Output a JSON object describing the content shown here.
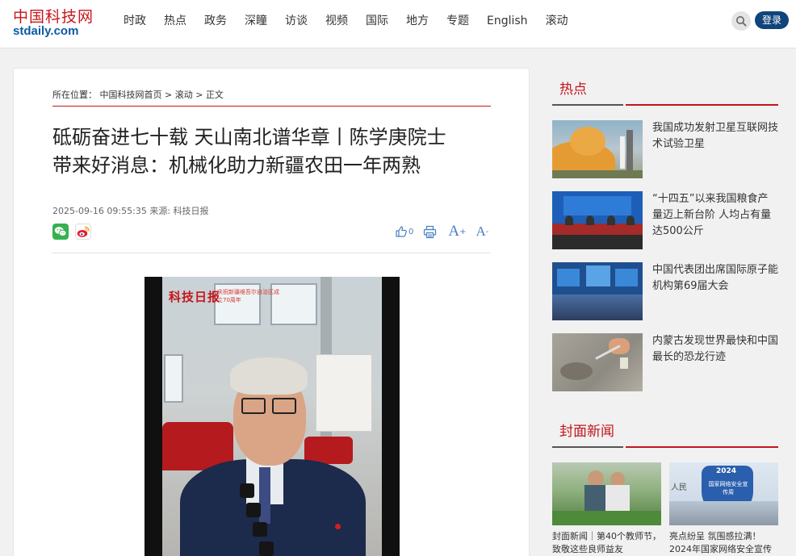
{
  "header": {
    "logo_cn": "中国科技网",
    "logo_en": "stdaily.com",
    "nav": [
      "时政",
      "热点",
      "政务",
      "深瞳",
      "访谈",
      "视频",
      "国际",
      "地方",
      "专题",
      "English",
      "滚动"
    ],
    "login": "登录"
  },
  "article": {
    "breadcrumb_label": "所在位置：",
    "breadcrumb_home": "中国科技网首页",
    "breadcrumb_sep": ">",
    "breadcrumb_section": "滚动",
    "breadcrumb_current": "正文",
    "title_line1": "砥砺奋进七十载 天山南北谱华章丨陈学庚院士",
    "title_line2": "带来好消息：机械化助力新疆农田一年两熟",
    "meta": "2025-09-16 09:55:35 来源: 科技日报",
    "likes": "0",
    "font_big": "A",
    "font_small": "A",
    "font_plus": "+",
    "font_minus": "-",
    "video_logo": "科技日报",
    "video_caption": "庆祝新疆维吾尔自治区成立70周年"
  },
  "sidebar": {
    "hot_title": "热点",
    "hot_items": [
      {
        "text": "我国成功发射卫星互联网技术试验卫星"
      },
      {
        "text": "“十四五”以来我国粮食产量迈上新台阶 人均占有量达500公斤"
      },
      {
        "text": "中国代表团出席国际原子能机构第69届大会"
      },
      {
        "text": "内蒙古发现世界最快和中国最长的恐龙行迹"
      }
    ],
    "cover_title": "封面新闻",
    "cover_items": [
      {
        "text": "封面新闻｜第40个教师节，致敬这些良师益友"
      },
      {
        "text": "亮点纷呈 氛围感拉满！2024年国家网络安全宣传"
      }
    ],
    "cover2_img_year": "2024",
    "cover2_img_text": "国家网络安全宣传周",
    "cover2_img_side": "人民"
  },
  "colors": {
    "brand_red": "#c3161c",
    "brand_blue": "#0c5aa6",
    "login_bg": "#10447a",
    "tool_blue": "#4a7fc1"
  }
}
